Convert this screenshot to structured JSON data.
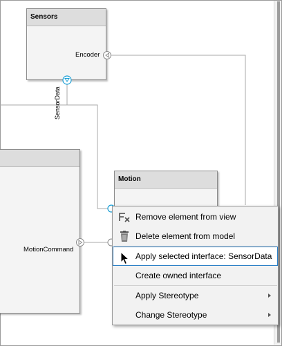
{
  "components": {
    "sensors": {
      "title": "Sensors",
      "port_label": "Encoder",
      "bus_label": "SensorData"
    },
    "left_block": {
      "port_label": "MotionCommand"
    },
    "motion": {
      "title": "Motion"
    }
  },
  "context_menu": {
    "items": [
      {
        "label": "Remove element from view",
        "icon": "remove-from-view-icon"
      },
      {
        "label": "Delete element from model",
        "icon": "trash-icon"
      },
      {
        "label": "Apply selected interface: SensorData"
      },
      {
        "label": "Create owned interface"
      },
      {
        "label": "Apply Stereotype",
        "submenu": true
      },
      {
        "label": "Change Stereotype",
        "submenu": true
      }
    ]
  },
  "colors": {
    "port_accent": "#1a9fd6",
    "selection_border": "#2b7fc6"
  }
}
